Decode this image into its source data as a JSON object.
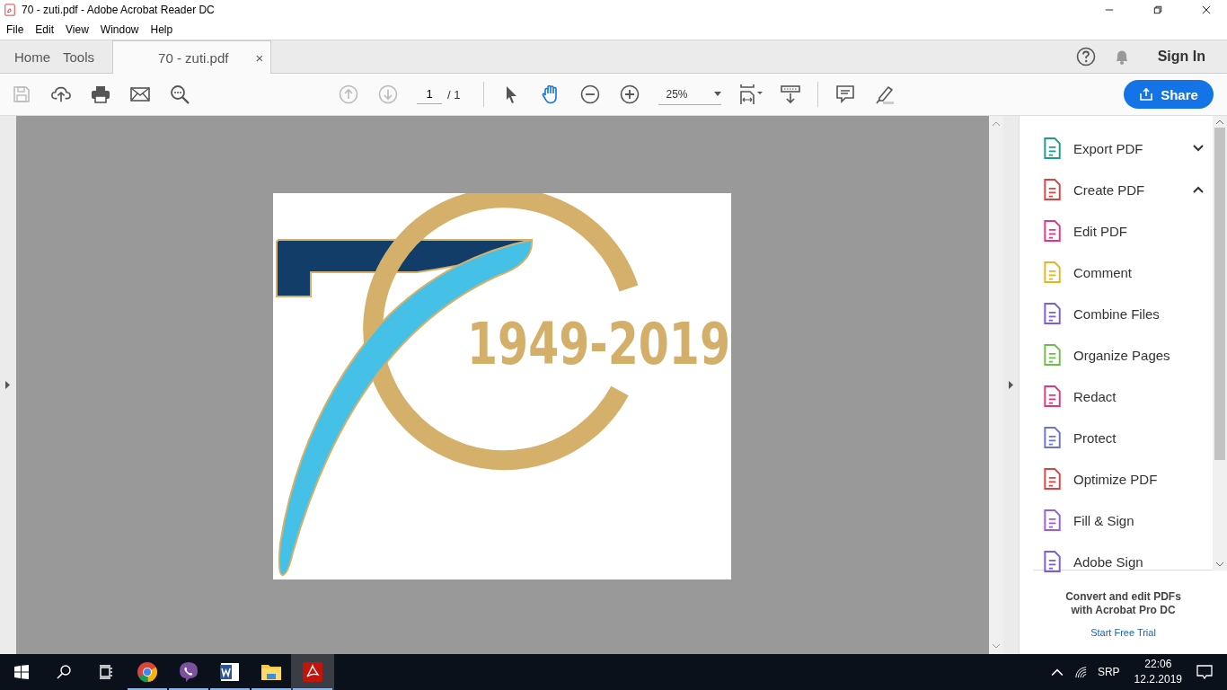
{
  "window": {
    "title": "70 - zuti.pdf - Adobe Acrobat Reader DC"
  },
  "menu": [
    "File",
    "Edit",
    "View",
    "Window",
    "Help"
  ],
  "tabs": [
    {
      "label": "Home",
      "selected": false,
      "kind": "nav"
    },
    {
      "label": "Tools",
      "selected": false,
      "kind": "nav"
    },
    {
      "label": "70 - zuti.pdf",
      "selected": true,
      "kind": "document"
    }
  ],
  "close_glyph": "×",
  "sign_in": "Sign In",
  "toolbar": {
    "save": {
      "disabled": true
    },
    "page_buttons": [
      {
        "disabled": true
      },
      {
        "disabled": true
      }
    ],
    "page": "1",
    "page_total": "/ 1",
    "select_tools": [
      {
        "selected": false
      },
      {
        "selected": true
      }
    ],
    "zoom": "25%",
    "share": "Share"
  },
  "document": {
    "logo_text": "1949-2019"
  },
  "tools_panel": {
    "items": [
      {
        "label": "Export PDF",
        "color": "#1a9e8f",
        "expanded": false
      },
      {
        "label": "Create PDF",
        "color": "#e0403f",
        "expanded": true
      },
      {
        "label": "Edit PDF",
        "color": "#e6348a"
      },
      {
        "label": "Comment",
        "color": "#e8b51e"
      },
      {
        "label": "Combine Files",
        "color": "#7a5ce6"
      },
      {
        "label": "Organize Pages",
        "color": "#6cc04a"
      },
      {
        "label": "Redact",
        "color": "#e0387a"
      },
      {
        "label": "Protect",
        "color": "#6a72e0"
      },
      {
        "label": "Optimize PDF",
        "color": "#e0403f"
      },
      {
        "label": "Fill & Sign",
        "color": "#9a5ce6"
      },
      {
        "label": "Adobe Sign",
        "color": "#7a5ce6"
      }
    ],
    "promo": "Convert and edit PDFs with Acrobat Pro DC",
    "trial_link": "Start Free Trial"
  },
  "taskbar": {
    "apps": [
      {
        "running": true,
        "selected": false
      },
      {
        "running": true,
        "selected": false
      },
      {
        "running": true,
        "selected": false
      },
      {
        "running": true,
        "selected": false
      },
      {
        "running": true,
        "selected": true
      }
    ],
    "language": "SRP",
    "time": "22:06",
    "date": "12.2.2019"
  }
}
